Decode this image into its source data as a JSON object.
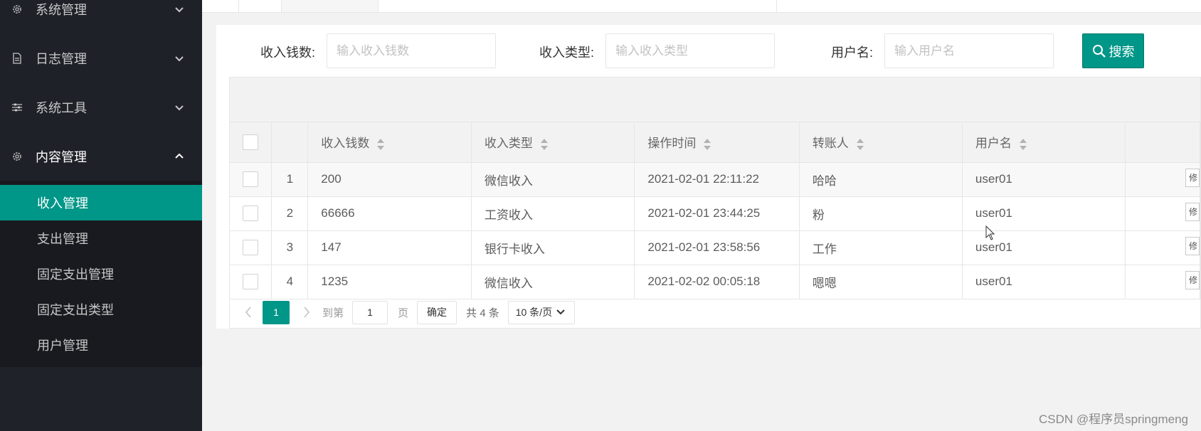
{
  "sidebar": {
    "groups": [
      {
        "label": "系统管理",
        "icon": "gear-icon",
        "open": false
      },
      {
        "label": "日志管理",
        "icon": "document-icon",
        "open": false
      },
      {
        "label": "系统工具",
        "icon": "sliders-icon",
        "open": false
      },
      {
        "label": "内容管理",
        "icon": "gear-icon",
        "open": true
      }
    ],
    "content_items": [
      {
        "label": "收入管理",
        "active": true
      },
      {
        "label": "支出管理",
        "active": false
      },
      {
        "label": "固定支出管理",
        "active": false
      },
      {
        "label": "固定支出类型",
        "active": false
      },
      {
        "label": "用户管理",
        "active": false
      }
    ]
  },
  "search": {
    "amount_label": "收入钱数:",
    "amount_placeholder": "输入收入钱数",
    "type_label": "收入类型:",
    "type_placeholder": "输入收入类型",
    "user_label": "用户名:",
    "user_placeholder": "输入用户名",
    "button_label": "搜索"
  },
  "table": {
    "columns": [
      "收入钱数",
      "收入类型",
      "操作时间",
      "转账人",
      "用户名"
    ],
    "rows": [
      {
        "no": "1",
        "amount": "200",
        "type": "微信收入",
        "time": "2021-02-01 22:11:22",
        "payer": "哈哈",
        "user": "user01"
      },
      {
        "no": "2",
        "amount": "66666",
        "type": "工资收入",
        "time": "2021-02-01 23:44:25",
        "payer": "粉",
        "user": "user01"
      },
      {
        "no": "3",
        "amount": "147",
        "type": "银行卡收入",
        "time": "2021-02-01 23:58:56",
        "payer": "工作",
        "user": "user01"
      },
      {
        "no": "4",
        "amount": "1235",
        "type": "微信收入",
        "time": "2021-02-02 00:05:18",
        "payer": "嗯嗯",
        "user": "user01"
      }
    ],
    "row_action_label": "修"
  },
  "pager": {
    "current_page": "1",
    "goto_label": "到第",
    "goto_value": "1",
    "page_suffix": "页",
    "confirm_label": "确定",
    "total_label": "共 4 条",
    "page_size_label": "10 条/页"
  },
  "watermark": "CSDN @程序员springmeng",
  "colors": {
    "accent": "#009688",
    "sidebar_bg": "#20222a",
    "submenu_bg": "#181a1f"
  }
}
